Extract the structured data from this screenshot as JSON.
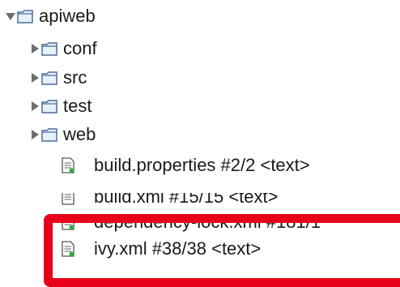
{
  "tree": {
    "root": {
      "label": "apiweb",
      "expanded": true,
      "icon": "folder-icon"
    },
    "folders": [
      {
        "label": "conf",
        "icon": "folder-icon"
      },
      {
        "label": "src",
        "icon": "folder-icon"
      },
      {
        "label": "test",
        "icon": "folder-icon"
      },
      {
        "label": "web",
        "icon": "folder-icon"
      }
    ],
    "files": [
      {
        "label": "build.properties #2/2 <text>",
        "icon": "text-file-icon"
      },
      {
        "label": "build.xml #15/15 <text>",
        "icon": "text-file-icon"
      },
      {
        "label": "dependency-lock.xml #181/1",
        "icon": "text-file-icon"
      },
      {
        "label": "ivy.xml #38/38 <text>",
        "icon": "text-file-icon"
      }
    ]
  },
  "colors": {
    "highlight": "#e6001a",
    "folder_stroke": "#4b6e9e",
    "folder_fill": "#e8f0fa",
    "file_badge": "#2eaa3a"
  }
}
